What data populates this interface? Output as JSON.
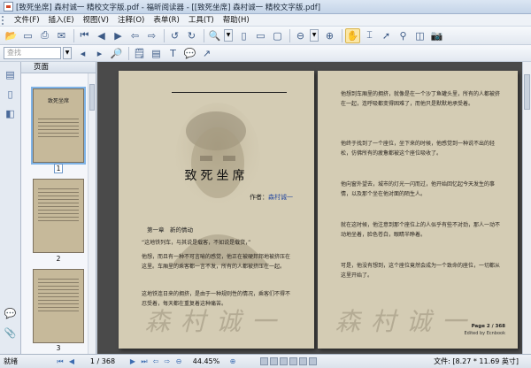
{
  "window": {
    "title": "[致死坐席] 森村诚一 精校文字版.pdf - 福昕阅读器 - [[致死坐席] 森村诚一 精校文字版.pdf]"
  },
  "menu": {
    "items": [
      "文件(F)",
      "插入(E)",
      "视图(V)",
      "注释(O)",
      "表单(R)",
      "工具(T)",
      "帮助(H)"
    ]
  },
  "toolbar2": {
    "search_placeholder": "查找"
  },
  "panel": {
    "title": "页面",
    "thumbnails": [
      {
        "title": "致死坐席",
        "number": "1"
      },
      {
        "title": "",
        "number": "2"
      },
      {
        "title": "",
        "number": "3"
      }
    ]
  },
  "left_page": {
    "title": "致死坐席",
    "author_label": "作者：",
    "author_name": "森村诚一",
    "chapter": "第一章　新的情动",
    "para1": "“这地铁列车，与其说是载客，不如说是载货，”",
    "para2": "他想，而且有一种不可言喻的感觉，他正在被硬邦邦地被挤压在这里。车厢里的乘客都一言不发，所有的人都被挤压在一起。",
    "para3": "这地铁连日来的拥挤，是由于一种规则性的情况，乘客们不得不忍受着，每天都在重复着这种痛苦。",
    "watermark": "森村诚一"
  },
  "right_page": {
    "para1": "他想到车厢里的拥挤，就像是在一个沙丁鱼罐头里，所有的人都被挤在一起，连呼吸都变得困难了，而他只是默默地承受着。",
    "para2": "他终于找到了一个座位，坐下来的时候，他感觉到一种说不出的轻松，仿佛所有的疲惫都被这个座位吸收了。",
    "para3": "他向窗外望去，城市的灯光一闪而过，他开始回忆起今天发生的事情，以及那个坐在他对面的陌生人。",
    "para4": "就在这时候，他注意到那个座位上的人似乎有些不对劲，那人一动不动地坐着，脸色苍白，眼睛半睁着。",
    "para5": "可是，他没有想到，这个座位竟然会成为一个致命的座位，一切都从这里开始了。",
    "watermark": "森村诚一",
    "page_no": "Page 2 / 368",
    "credit": "Edited by Ecnbook"
  },
  "status": {
    "ready": "就绪",
    "page_indicator": "1 / 368",
    "zoom": "44.45%",
    "dims": "文件: [8.27 * 11.69 英寸]"
  },
  "colors": {
    "page_bg": "#d4ccb4",
    "doc_bg": "#4a4a4a",
    "accent": "#2a4ca0"
  }
}
